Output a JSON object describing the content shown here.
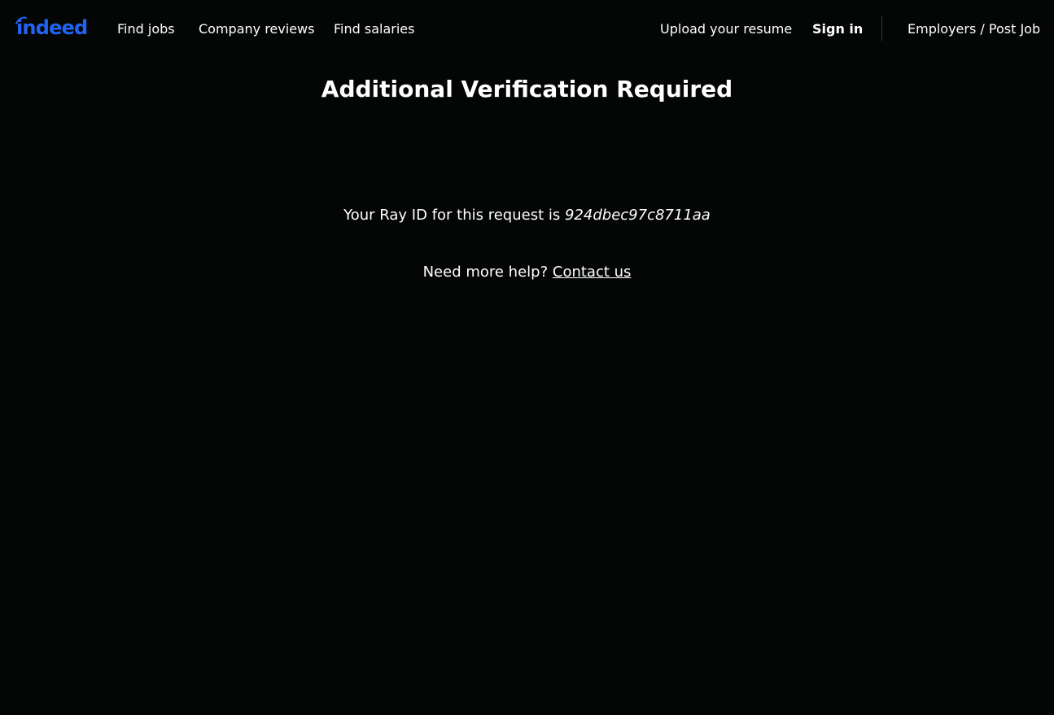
{
  "header": {
    "logo_text": "indeed",
    "nav_left": [
      "Find jobs",
      "Company reviews",
      "Find salaries"
    ],
    "upload_resume": "Upload your resume",
    "sign_in": "Sign in",
    "employers": "Employers / Post Job"
  },
  "main": {
    "title": "Additional Verification Required",
    "ray_prefix": "Your Ray ID for this request is ",
    "ray_id": "924dbec97c8711aa",
    "help_prefix": "Need more help? ",
    "contact_link": "Contact us"
  },
  "colors": {
    "background": "#040505",
    "brand": "#2164f3",
    "text": "#ffffff"
  }
}
